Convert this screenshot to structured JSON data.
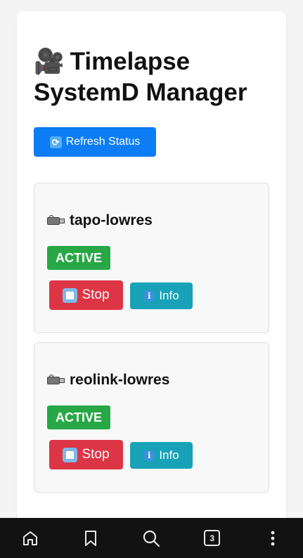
{
  "header": {
    "title_emoji": "🎥",
    "title": "Timelapse SystemD Manager"
  },
  "toolbar": {
    "refresh_label": "Refresh Status",
    "refresh_icon": "refresh-icon"
  },
  "services": [
    {
      "name": "tapo-lowres",
      "status": "ACTIVE",
      "stop_label": "Stop",
      "info_label": "Info"
    },
    {
      "name": "reolink-lowres",
      "status": "ACTIVE",
      "stop_label": "Stop",
      "info_label": "Info"
    }
  ],
  "bottom_nav": {
    "items": [
      "home-icon",
      "bookmark-icon",
      "search-icon",
      "tabs-icon",
      "more-icon"
    ],
    "tab_count": "3"
  },
  "colors": {
    "primary": "#0d7df5",
    "success": "#27a745",
    "danger": "#dc3545",
    "info": "#17a2b8",
    "nav_bg": "#121212"
  }
}
